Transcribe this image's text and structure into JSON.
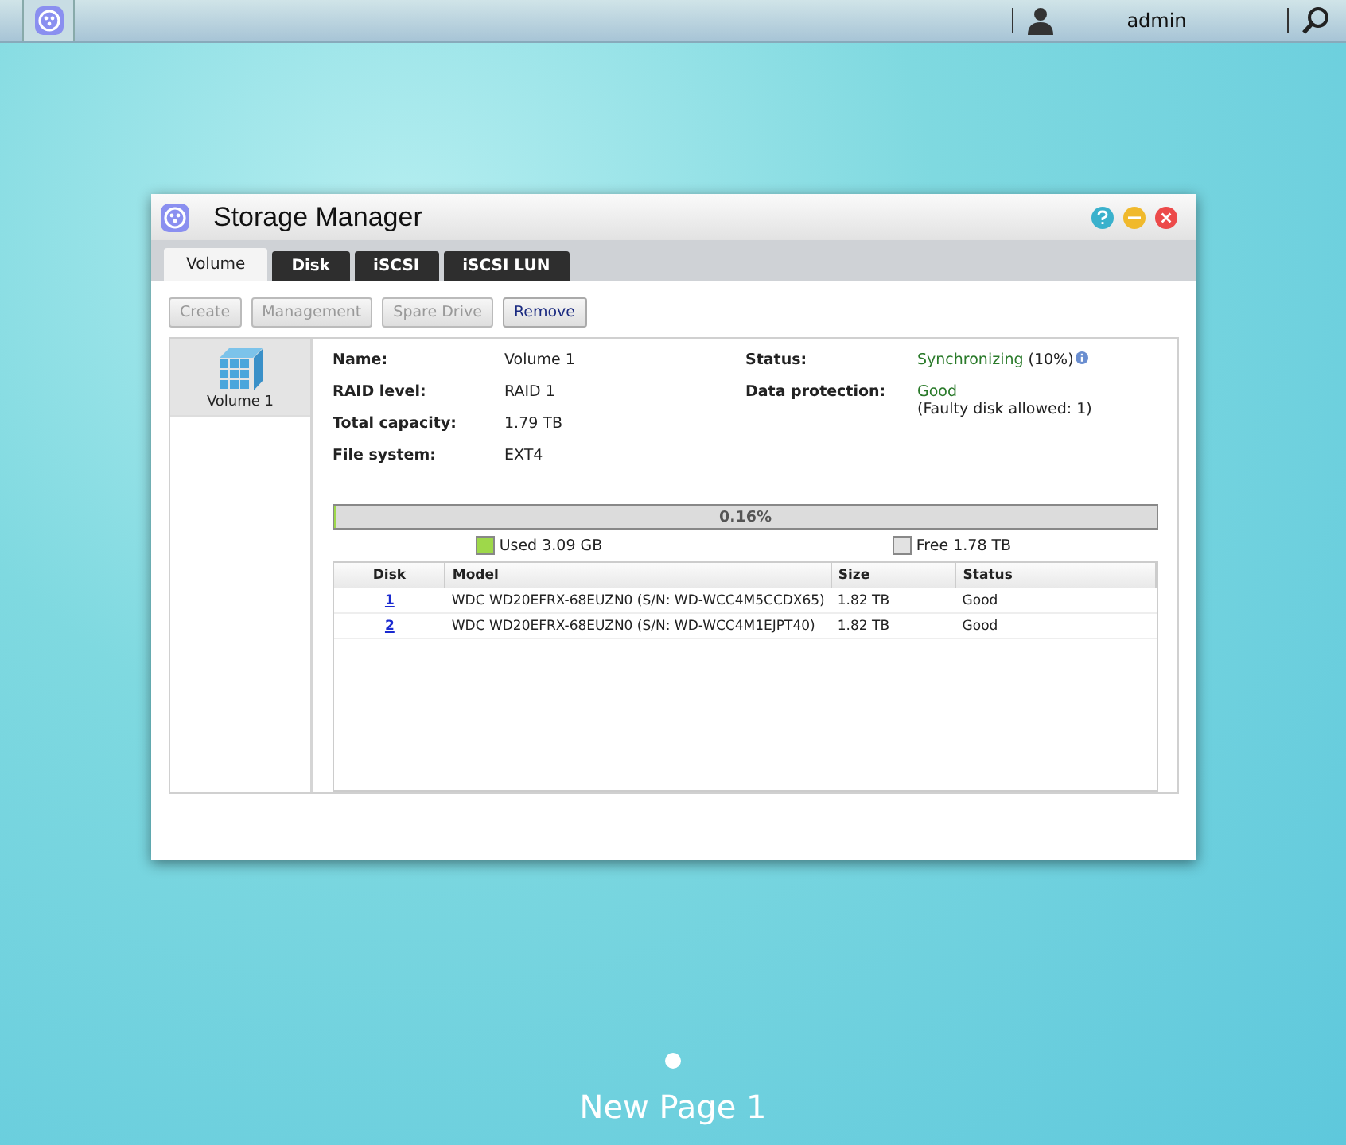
{
  "top_bar": {
    "user": "admin"
  },
  "window": {
    "title": "Storage Manager",
    "tabs": [
      {
        "label": "Volume",
        "selected": true
      },
      {
        "label": "Disk",
        "selected": false
      },
      {
        "label": "iSCSI",
        "selected": false
      },
      {
        "label": "iSCSI LUN",
        "selected": false
      }
    ],
    "toolbar": [
      {
        "label": "Create",
        "disabled": true
      },
      {
        "label": "Management",
        "disabled": true
      },
      {
        "label": "Spare Drive",
        "disabled": true
      },
      {
        "label": "Remove",
        "disabled": false
      }
    ],
    "volumes": [
      {
        "label": "Volume 1",
        "selected": true
      }
    ],
    "details_left": [
      {
        "label": "Name:",
        "value": "Volume 1"
      },
      {
        "label": "RAID level:",
        "value": "RAID 1"
      },
      {
        "label": "Total capacity:",
        "value": "1.79 TB"
      },
      {
        "label": "File system:",
        "value": "EXT4"
      }
    ],
    "details_right": [
      {
        "label": "Status:",
        "value": "Synchronizing",
        "extra": "(10%)",
        "info": true
      },
      {
        "label": "Data protection:",
        "value": "Good",
        "extra": "(Faulty disk allowed: 1)",
        "info": false
      }
    ],
    "usage": {
      "level": 0.0016,
      "reading": "0.16%",
      "legend": [
        {
          "label": "Used 3.09 GB",
          "color": "#9ed84a"
        },
        {
          "label": "Free 1.78 TB",
          "color": "#e2e2e2"
        }
      ]
    },
    "disk_table": {
      "columns": [
        "Disk",
        "Model",
        "Size",
        "Status"
      ],
      "rows": [
        [
          "1",
          "WDC WD20EFRX-68EUZN0 (S/N: WD-WCC4M5CCDX65)",
          "1.82 TB",
          "Good"
        ],
        [
          "2",
          "WDC WD20EFRX-68EUZN0 (S/N: WD-WCC4M1EJPT40)",
          "1.82 TB",
          "Good"
        ]
      ]
    }
  },
  "pager": {
    "dots": [
      {
        "selected": true
      }
    ],
    "label": "New Page 1"
  }
}
